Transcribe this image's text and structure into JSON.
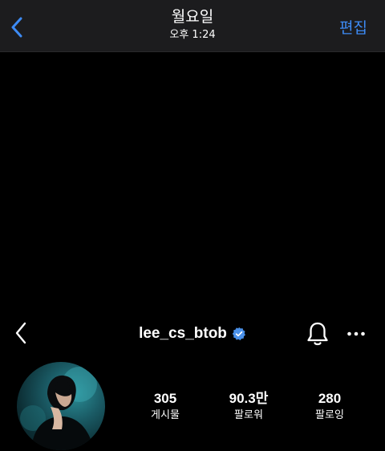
{
  "photo_header": {
    "title": "월요일",
    "subtitle": "오후 1:24",
    "edit_label": "편집",
    "accent_color": "#3d8bf5",
    "back_icon": "chevron-left-icon"
  },
  "instagram": {
    "username": "lee_cs_btob",
    "verified": true,
    "icons": [
      "chevron-left-icon",
      "verified-badge-icon",
      "bell-icon",
      "more-horizontal-icon"
    ],
    "stats": [
      {
        "value": "305",
        "label": "게시물"
      },
      {
        "value": "90.3만",
        "label": "팔로워"
      },
      {
        "value": "280",
        "label": "팔로잉"
      }
    ]
  }
}
